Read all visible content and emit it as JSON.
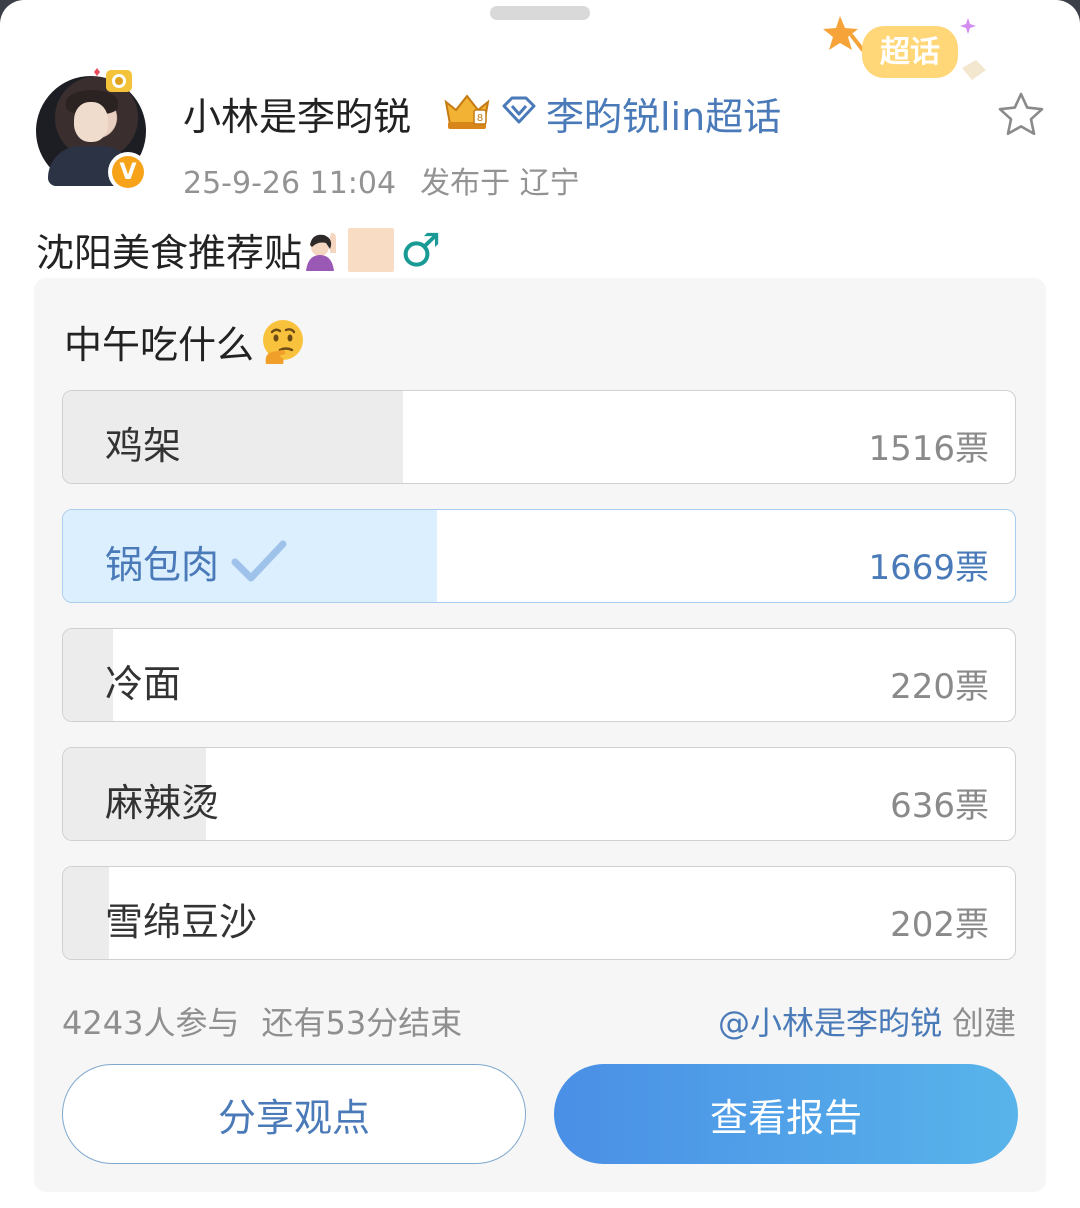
{
  "header": {
    "username": "小林是李昀锐",
    "topic": "李昀锐lin超话",
    "badge_text": "超话",
    "verified_mark": "V",
    "timestamp": "25-9-26 11:04",
    "location": "发布于 辽宁"
  },
  "post": {
    "text": "沈阳美食推荐贴",
    "male_symbol": "♂"
  },
  "poll": {
    "title": "中午吃什么",
    "options": [
      {
        "label": "鸡架",
        "votes": "1516票",
        "fraction": 0.357,
        "selected": false
      },
      {
        "label": "锅包肉",
        "votes": "1669票",
        "fraction": 0.393,
        "selected": true
      },
      {
        "label": "冷面",
        "votes": "220票",
        "fraction": 0.052,
        "selected": false
      },
      {
        "label": "麻辣烫",
        "votes": "636票",
        "fraction": 0.15,
        "selected": false
      },
      {
        "label": "雪绵豆沙",
        "votes": "202票",
        "fraction": 0.048,
        "selected": false
      }
    ],
    "participants": "4243人参与",
    "remaining": "还有53分结束",
    "creator": "@小林是李昀锐",
    "created_suffix": "创建",
    "share_label": "分享观点",
    "report_label": "查看报告"
  },
  "colors": {
    "accent": "#4a7ab8",
    "selected_fill": "#dcefff",
    "bar_fill": "#ececec"
  }
}
